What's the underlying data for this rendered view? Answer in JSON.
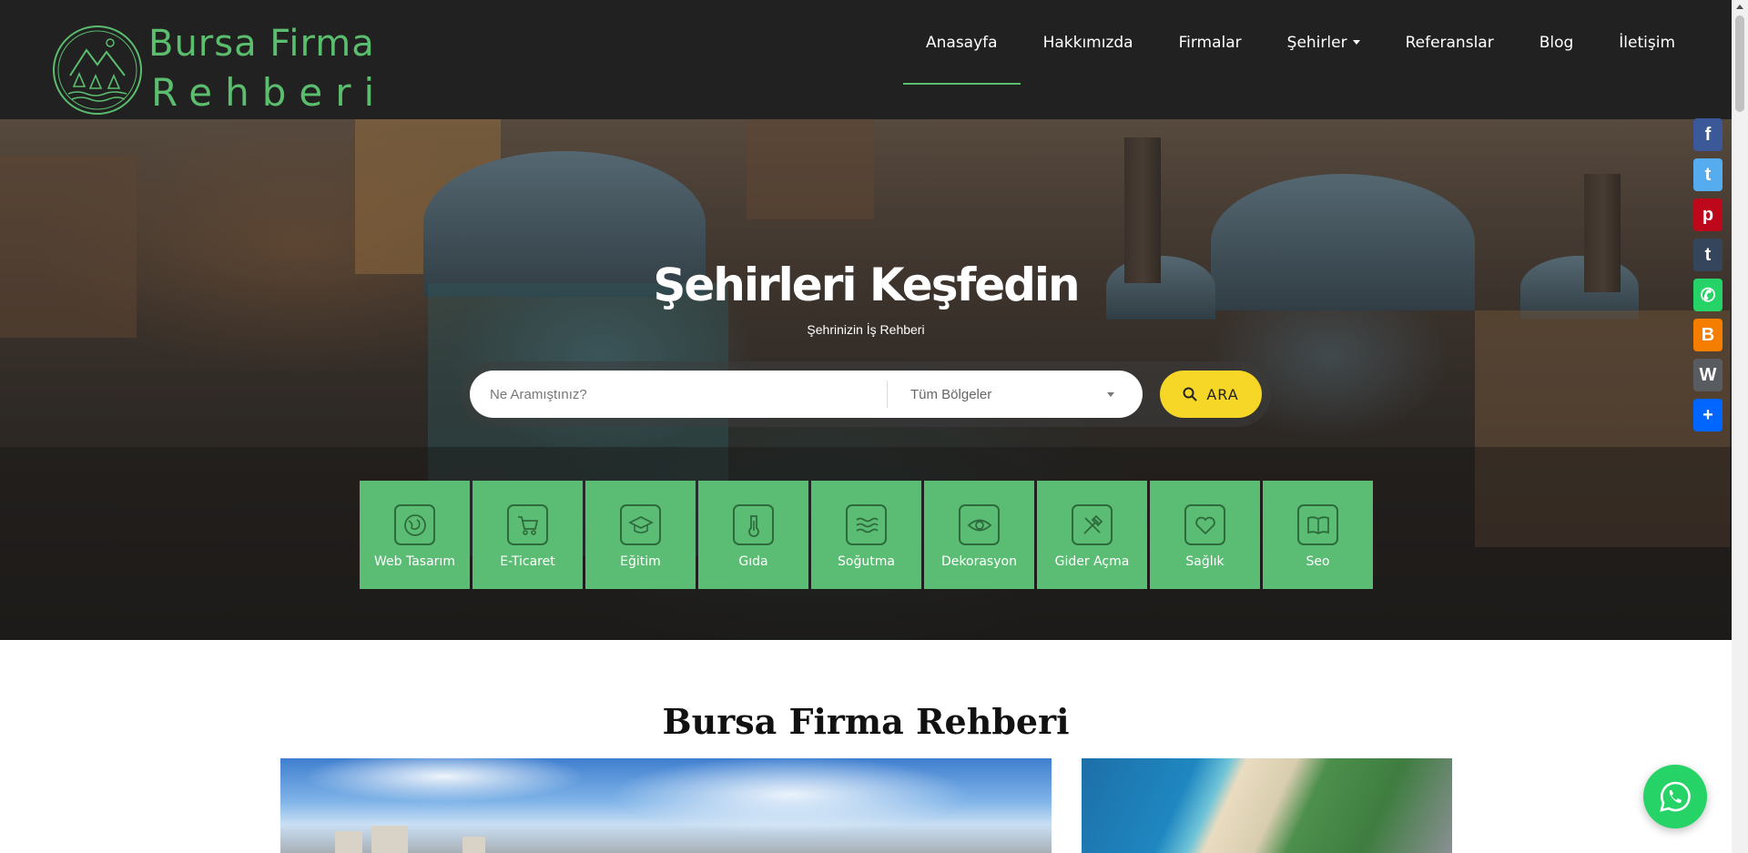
{
  "brand": {
    "line1": "Bursa Firma",
    "line2": "Rehberi",
    "color": "#5bbd6e"
  },
  "nav": {
    "items": [
      {
        "label": "Anasayfa",
        "active": true
      },
      {
        "label": "Hakkımızda"
      },
      {
        "label": "Firmalar"
      },
      {
        "label": "Şehirler",
        "dropdown": true
      },
      {
        "label": "Referanslar"
      },
      {
        "label": "Blog"
      },
      {
        "label": "İletişim"
      }
    ]
  },
  "hero": {
    "title": "Şehirleri Keşfedin",
    "subtitle": "Şehrinizin İş Rehberi",
    "search": {
      "placeholder": "Ne Aramıştınız?",
      "region_value": "Tüm Bölgeler",
      "button_label": "ARA",
      "button_color": "#f6d627"
    },
    "categories": [
      {
        "label": "Web Tasarım",
        "icon": "globe-icon"
      },
      {
        "label": "E-Ticaret",
        "icon": "cart-icon"
      },
      {
        "label": "Eğitim",
        "icon": "graduation-cap-icon"
      },
      {
        "label": "Gıda",
        "icon": "thermometer-icon"
      },
      {
        "label": "Soğutma",
        "icon": "waves-icon"
      },
      {
        "label": "Dekorasyon",
        "icon": "eye-icon"
      },
      {
        "label": "Gider Açma",
        "icon": "tools-icon"
      },
      {
        "label": "Sağlık",
        "icon": "heart-icon"
      },
      {
        "label": "Seo",
        "icon": "book-icon"
      }
    ],
    "category_color": "#5bbd74"
  },
  "share": {
    "buttons": [
      {
        "name": "facebook",
        "icon": "facebook-icon",
        "color": "#3b5998",
        "glyph": "f"
      },
      {
        "name": "twitter",
        "icon": "twitter-icon",
        "color": "#55acee",
        "glyph": "t"
      },
      {
        "name": "pinterest",
        "icon": "pinterest-icon",
        "color": "#bd081c",
        "glyph": "p"
      },
      {
        "name": "tumblr",
        "icon": "tumblr-icon",
        "color": "#35465c",
        "glyph": "t"
      },
      {
        "name": "whatsapp",
        "icon": "whatsapp-icon",
        "color": "#25d366",
        "glyph": "✆"
      },
      {
        "name": "blogger",
        "icon": "blogger-icon",
        "color": "#f57d00",
        "glyph": "B"
      },
      {
        "name": "wordpress",
        "icon": "wordpress-icon",
        "color": "#585c60",
        "glyph": "W"
      },
      {
        "name": "share",
        "icon": "plus-share-icon",
        "color": "#0166ff",
        "glyph": "+"
      }
    ]
  },
  "section": {
    "title": "Bursa Firma Rehberi"
  }
}
